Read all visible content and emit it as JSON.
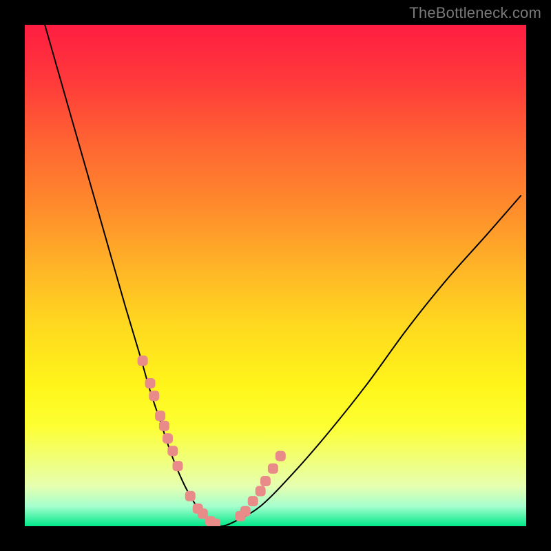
{
  "watermark": "TheBottleneck.com",
  "chart_data": {
    "type": "line",
    "title": "",
    "xlabel": "",
    "ylabel": "",
    "xlim": [
      0,
      100
    ],
    "ylim": [
      0,
      100
    ],
    "grid": false,
    "legend": false,
    "series": [
      {
        "name": "bottleneck-curve",
        "x": [
          4,
          8,
          12,
          16,
          20,
          23,
          25,
          27,
          29,
          31,
          33,
          35,
          37,
          39,
          42,
          47,
          53,
          60,
          68,
          76,
          84,
          92,
          99
        ],
        "y": [
          100,
          86,
          72,
          58,
          44,
          34,
          27,
          21,
          15,
          10,
          6,
          3,
          1,
          0,
          1,
          4,
          10,
          18,
          28,
          39,
          49,
          58,
          66
        ],
        "color": "#000000",
        "stroke_width": 2
      }
    ],
    "markers": [
      {
        "name": "highlight-dots",
        "shape": "rounded-rect",
        "color": "#e98b88",
        "points_x": [
          23.5,
          25,
          25.8,
          27,
          27.8,
          28.5,
          29.5,
          30.5,
          33,
          34.5,
          35.5,
          37,
          38,
          43,
          44,
          45.5,
          47,
          48,
          49.5,
          51
        ],
        "points_y": [
          33,
          28.5,
          26,
          22,
          20,
          17.5,
          15,
          12,
          6,
          3.5,
          2.5,
          1,
          0.5,
          2,
          3,
          5,
          7,
          9,
          11.5,
          14
        ]
      }
    ],
    "background_gradient": {
      "stops": [
        {
          "pos": 0.0,
          "color": "#ff1d42"
        },
        {
          "pos": 0.5,
          "color": "#ffb327"
        },
        {
          "pos": 0.8,
          "color": "#fdff32"
        },
        {
          "pos": 0.96,
          "color": "#a6ffce"
        },
        {
          "pos": 1.0,
          "color": "#00e889"
        }
      ]
    }
  }
}
